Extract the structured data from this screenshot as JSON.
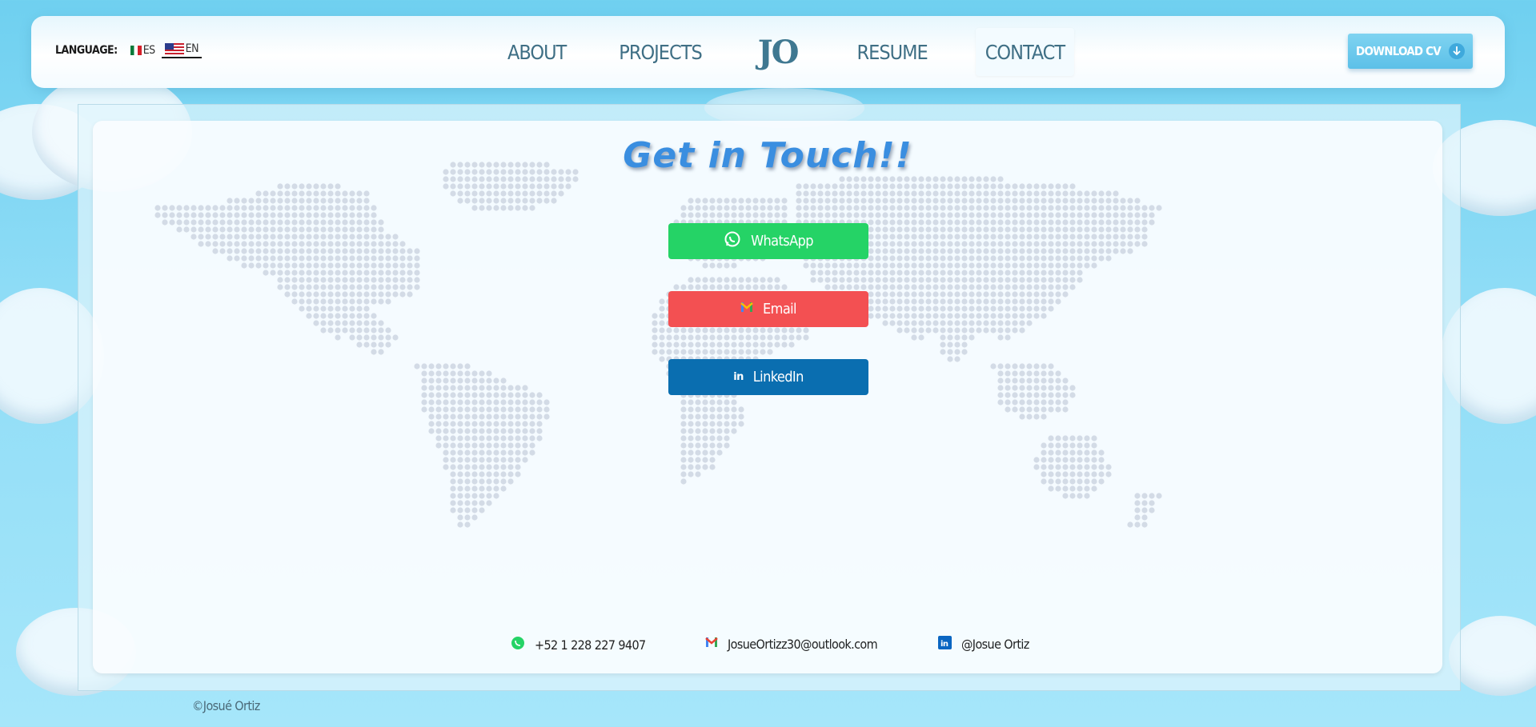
{
  "language": {
    "label": "LANGUAGE:",
    "options": [
      {
        "code": "ES",
        "flag": "mexico-flag"
      },
      {
        "code": "EN",
        "flag": "us-flag",
        "selected": true
      }
    ]
  },
  "nav": {
    "about": "ABOUT",
    "projects": "PROJECTS",
    "logo": "JO",
    "resume": "RESUME",
    "contact": "CONTACT"
  },
  "download": {
    "label": "DOWNLOAD CV",
    "icon": "download-arrow-icon"
  },
  "main": {
    "title": "Get in Touch!!",
    "buttons": [
      {
        "label": "WhatsApp",
        "icon": "whatsapp-icon",
        "color": "#25d366"
      },
      {
        "label": "Email",
        "icon": "gmail-icon",
        "color": "#f35052"
      },
      {
        "label": "LinkedIn",
        "icon": "linkedin-icon",
        "color": "#0a6eb0"
      }
    ],
    "contacts": [
      {
        "icon": "whatsapp-icon",
        "text": "+52 1 228 227 9407"
      },
      {
        "icon": "gmail-icon",
        "text": "JosueOrtizz30@outlook.com"
      },
      {
        "icon": "linkedin-icon",
        "text": "@Josue Ortiz"
      }
    ]
  },
  "footer": {
    "copyright": "©Josué Ortiz"
  },
  "colors": {
    "accent": "#3a8ee0",
    "nav_text": "#3f6f85",
    "background": "#8edcf6"
  }
}
